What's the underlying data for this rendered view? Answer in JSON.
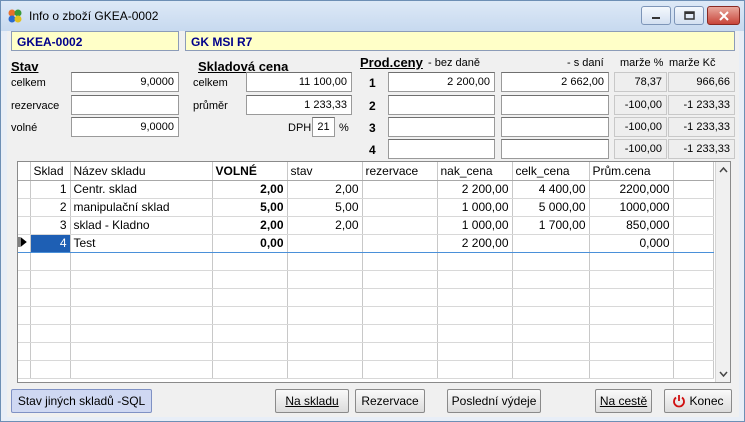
{
  "window": {
    "title": "Info o zboží GKEA-0002"
  },
  "header": {
    "code": "GKEA-0002",
    "name": "GK MSI R7"
  },
  "stav": {
    "title": "Stav",
    "rows": [
      {
        "label": "celkem",
        "value": "9,0000"
      },
      {
        "label": "rezervace",
        "value": ""
      },
      {
        "label": "volné",
        "value": "9,0000"
      }
    ]
  },
  "skladova_cena": {
    "title": "Skladová cena",
    "celkem_label": "celkem",
    "celkem": "11 100,00",
    "prumer_label": "průměr",
    "prumer": "1 233,33",
    "dph_label": "DPH",
    "dph": "21",
    "dph_unit": "%"
  },
  "prod_ceny": {
    "title": "Prod.ceny",
    "col_bez": "- bez daně",
    "col_s": "- s daní",
    "col_marze_pct": "marže %",
    "col_marze_kc": "marže Kč",
    "rows": [
      {
        "n": "1",
        "bez": "2 200,00",
        "s": "2 662,00",
        "mp": "78,37",
        "mk": "966,66"
      },
      {
        "n": "2",
        "bez": "",
        "s": "",
        "mp": "-100,00",
        "mk": "-1 233,33"
      },
      {
        "n": "3",
        "bez": "",
        "s": "",
        "mp": "-100,00",
        "mk": "-1 233,33"
      },
      {
        "n": "4",
        "bez": "",
        "s": "",
        "mp": "-100,00",
        "mk": "-1 233,33"
      }
    ]
  },
  "table": {
    "columns": [
      "Sklad",
      "Název skladu",
      "VOLNÉ",
      "stav",
      "rezervace",
      "nak_cena",
      "celk_cena",
      "Prům.cena"
    ],
    "rows": [
      [
        "1",
        "Centr. sklad",
        "2,00",
        "2,00",
        "",
        "2 200,00",
        "4 400,00",
        "2200,000"
      ],
      [
        "2",
        "manipulační sklad",
        "5,00",
        "5,00",
        "",
        "1 000,00",
        "5 000,00",
        "1000,000"
      ],
      [
        "3",
        "sklad - Kladno",
        "2,00",
        "2,00",
        "",
        "1 000,00",
        "1 700,00",
        "850,000"
      ],
      [
        "4",
        "Test",
        "0,00",
        "",
        "",
        "2 200,00",
        "",
        "0,000"
      ]
    ]
  },
  "buttons": {
    "stav_jinych": "Stav jiných skladů -SQL",
    "na_skladu": "Na skladu",
    "rezervace": "Rezervace",
    "posledni_vydeje": "Poslední výdeje",
    "na_ceste": "Na cestě",
    "konec": "Konec"
  },
  "colors": {
    "header_bg": "#ffffc8",
    "header_text": "#00008b",
    "selection": "#1e5fb4",
    "konec_icon": "#d01010"
  }
}
